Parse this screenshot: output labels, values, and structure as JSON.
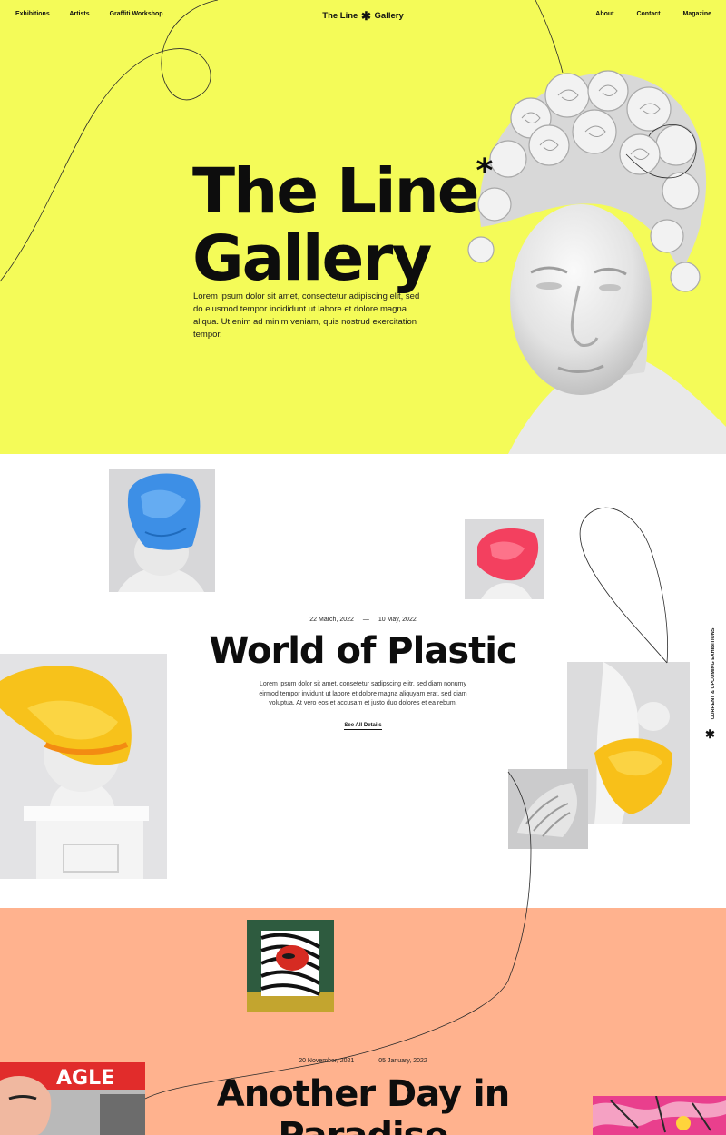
{
  "nav": {
    "left": [
      "Exhibitions",
      "Artists",
      "Graffiti Workshop"
    ],
    "right": [
      "About",
      "Contact",
      "Magazine"
    ],
    "brand_part1": "The Line",
    "brand_star": "✱",
    "brand_part2": "Gallery"
  },
  "hero": {
    "title_line1": "The Line",
    "title_star": "*",
    "title_line2": "Gallery",
    "description": "Lorem ipsum dolor sit amet, consectetur adipiscing elit, sed do eiusmod tempor incididunt ut labore et dolore magna aliqua. Ut enim ad minim veniam, quis nostrud exercitation tempor."
  },
  "side_label": {
    "text": "CURRENT & UPCOMING EXHIBITIONS",
    "star": "✱"
  },
  "exhibitions": [
    {
      "start": "22 March, 2022",
      "dash": "—",
      "end": "10 May, 2022",
      "title": "World of Plastic",
      "description": "Lorem ipsum dolor sit amet, consetetur sadipscing elitr, sed diam nonumy eirmod tempor invidunt ut labore et dolore magna aliquyam erat, sed diam voluptua. At vero eos et accusam et justo duo dolores et ea rebum.",
      "link": "See All Details"
    },
    {
      "start": "20 November, 2021",
      "dash": "—",
      "end": "05 January, 2022",
      "title_line1": "Another Day in",
      "title_line2": "Paradise"
    }
  ],
  "colors": {
    "hero_bg": "#f4fb58",
    "exhibition2_bg": "#ffb28e",
    "text": "#0d0d0d"
  }
}
